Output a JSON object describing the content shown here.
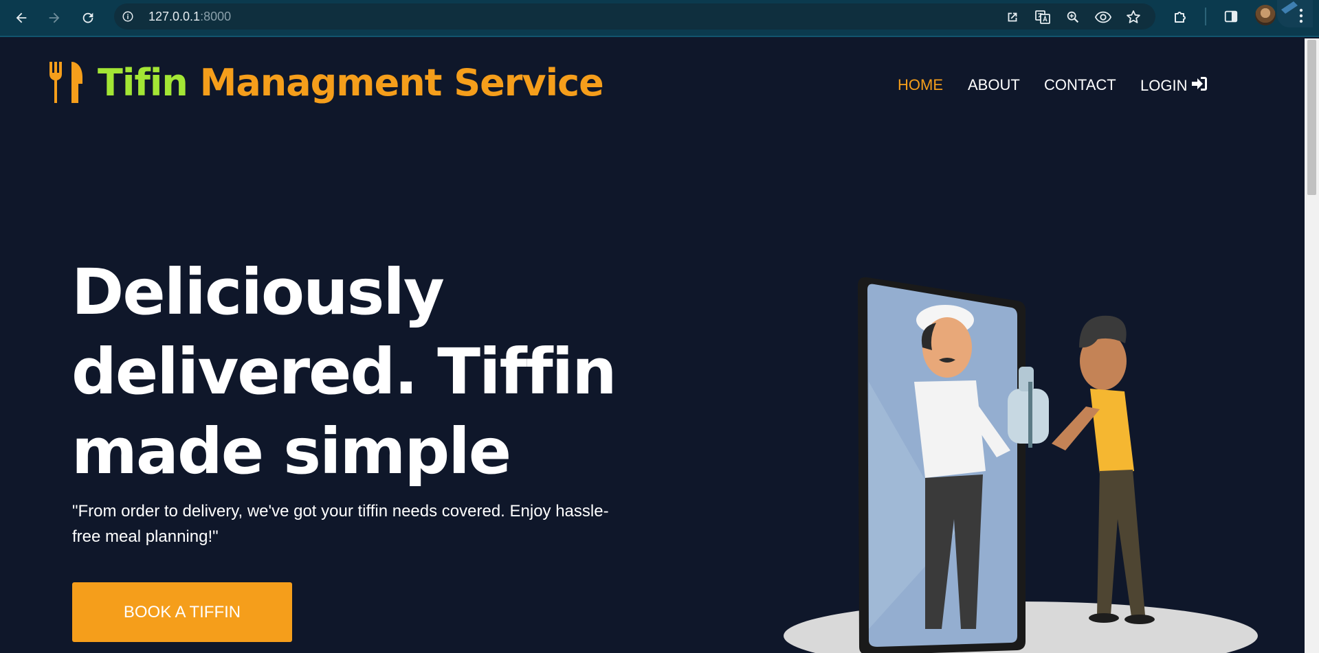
{
  "browser": {
    "url_host": "127.0.0.1",
    "url_port": ":8000",
    "icons": [
      "back-arrow-icon",
      "forward-arrow-icon",
      "reload-icon",
      "site-info-icon",
      "open-in-app-icon",
      "translate-icon",
      "zoom-icon",
      "eye-icon",
      "bookmark-star-icon",
      "extensions-puzzle-icon",
      "side-panel-icon",
      "profile-avatar",
      "menu-kebab-icon"
    ]
  },
  "brand": {
    "icon": "fork-knife-icon",
    "name_first": "Tifin",
    "name_rest": " Managment Service"
  },
  "nav": {
    "items": [
      {
        "label": "HOME",
        "active": true
      },
      {
        "label": "ABOUT",
        "active": false
      },
      {
        "label": "CONTACT",
        "active": false
      },
      {
        "label": "LOGIN",
        "active": false,
        "icon": "sign-in-icon"
      }
    ]
  },
  "hero": {
    "title": "Deliciously delivered. Tiffin made simple",
    "subtitle": "\"From order to delivery, we've got your tiffin needs covered. Enjoy hassle-free meal planning!\"",
    "cta_label": "BOOK A TIFFIN",
    "illustration": "delivery-handover-illustration"
  },
  "colors": {
    "background": "#0f172a",
    "accent_orange": "#f59e1b",
    "accent_green": "#a3e635",
    "text": "#ffffff",
    "chrome": "#0b3a4e"
  }
}
